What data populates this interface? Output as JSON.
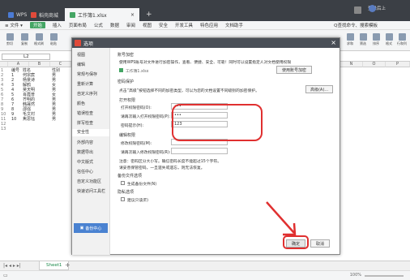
{
  "tabs": [
    {
      "label": "WPS",
      "color": "#4b7bd5"
    },
    {
      "label": "稻壳商城",
      "color": "#e04a3a"
    },
    {
      "label": "工作簿1.xlsx",
      "color": "#44a564"
    }
  ],
  "window_right": {
    "account": "登录后上"
  },
  "menu": {
    "file": "≡ 文件 ▾",
    "items": [
      "开始",
      "插入",
      "页面布局",
      "公式",
      "数据",
      "审阅",
      "视图",
      "安全",
      "开发工具",
      "特色应用",
      "文档助手"
    ],
    "search": "Q查找命令、搜索模板"
  },
  "ribbon": {
    "left": [
      "剪切",
      "复制",
      "格式刷",
      "粘贴"
    ],
    "right": [
      "求和",
      "筛选",
      "排序",
      "格式",
      "行和列"
    ]
  },
  "namebox": "L2",
  "columns": [
    "A",
    "B",
    "C",
    "D",
    "N",
    "O",
    "P"
  ],
  "sheet_rows": [
    {
      "n": "1",
      "a": "编号",
      "b": "姓名",
      "c": "性别"
    },
    {
      "n": "2",
      "a": "1",
      "b": "何宗宸",
      "c": "男"
    },
    {
      "n": "3",
      "a": "2",
      "b": "杨景诗",
      "c": "男"
    },
    {
      "n": "4",
      "a": "3",
      "b": "解鸥",
      "c": "女"
    },
    {
      "n": "5",
      "a": "4",
      "b": "吴天明",
      "c": "男"
    },
    {
      "n": "6",
      "a": "5",
      "b": "肖霞普",
      "c": "女"
    },
    {
      "n": "7",
      "a": "6",
      "b": "齐明的",
      "c": "男"
    },
    {
      "n": "8",
      "a": "7",
      "b": "韩晟然",
      "c": "男"
    },
    {
      "n": "9",
      "a": "8",
      "b": "邵强",
      "c": "男"
    },
    {
      "n": "10",
      "a": "9",
      "b": "毛文村",
      "c": "男"
    },
    {
      "n": "11",
      "a": "10",
      "b": "焦思钰",
      "c": "男"
    },
    {
      "n": "12",
      "a": "",
      "b": "",
      "c": ""
    },
    {
      "n": "13",
      "a": "",
      "b": "",
      "c": ""
    }
  ],
  "dialog": {
    "title": "选项",
    "close": "×",
    "nav": [
      "视图",
      "编辑",
      "常规与保存",
      "重新计算",
      "自定义序列",
      "颜色",
      "错误检查",
      "拼写检查",
      "安全性",
      "外部内容",
      "数据导出",
      "中文版式",
      "信任中心",
      "自定义功能区",
      "快速访问工具栏"
    ],
    "nav_active": "安全性",
    "backup_center": "备份中心",
    "sections": {
      "account": "账号加密",
      "account_desc": "使用WPS账号对文件进行加密操作，查看、便捷、安全、可靠！同时可以设置指定人对文档使用权限",
      "file_name": "工作簿1.xlsx",
      "account_btn": "使用账号加密",
      "password": "密码保护",
      "password_desc": "点击“高级”按钮选择不同的加密类型，可以为您的文档设置不同级别的加密保护。",
      "advanced_btn": "高级(A)...",
      "open_perm": "打开权限",
      "open_pwd_label": "打开权限密码(O):",
      "open_pwd_value": "•••",
      "confirm_label": "请再次输入打开权限密码(P):",
      "confirm_value": "•••",
      "hint_label": "密码提示(H):",
      "hint_value": "123",
      "edit_perm": "编辑权限",
      "edit_pwd_label": "修改权限密码(M):",
      "edit_confirm_label": "请再次输入修改权限密码(R):",
      "note1": "注意：密码区分大小写。确信密码长度不能超过15个字符。",
      "note2": "请妥善保管密码，一旦遗失或遗忘，则无法恢复。",
      "backup_label": "备份文件选项",
      "backup_cb": "生成备份文件(N)",
      "privacy_label": "隐私选项",
      "privacy_cb": "建议只读(E)",
      "ok": "确定",
      "cancel": "取消"
    }
  },
  "sheet_tab": "Sheet1",
  "status": {
    "left": "▭",
    "zoom": "100%"
  },
  "colors": {
    "accent": "#44a564",
    "highlight": "#e03030",
    "primary_btn": "#4a82d1"
  }
}
